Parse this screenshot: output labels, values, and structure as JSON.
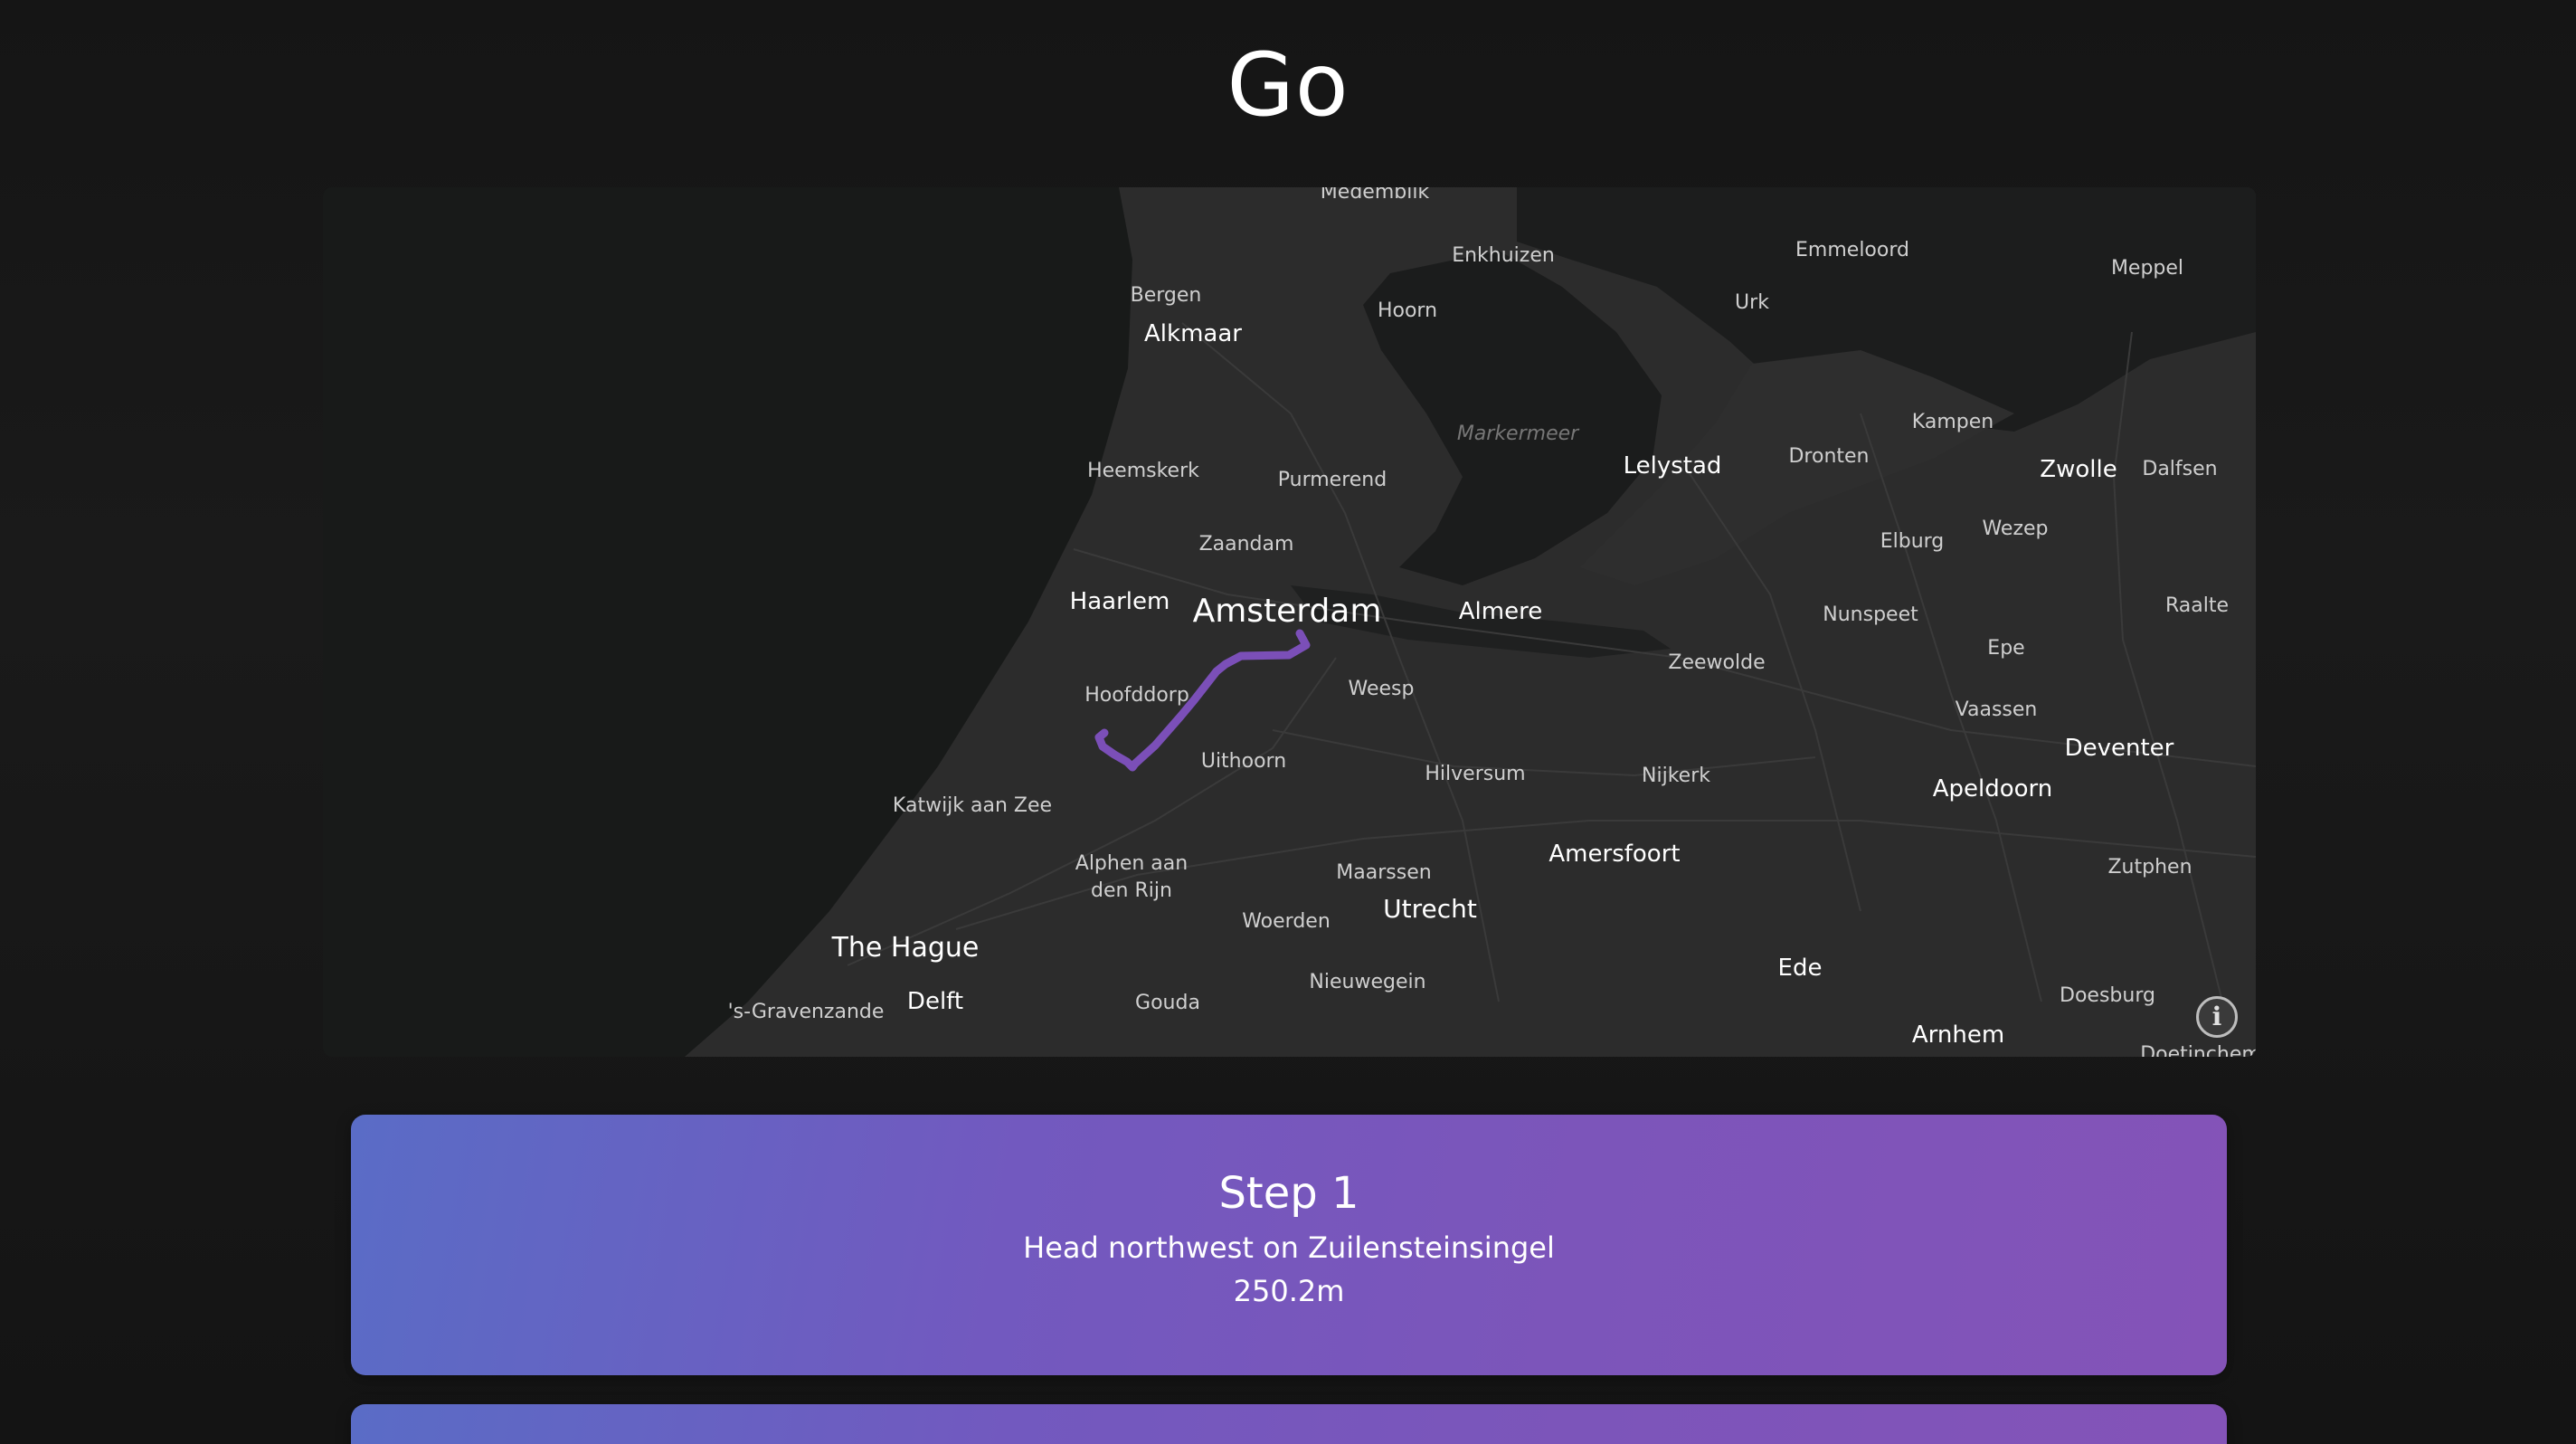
{
  "header": {
    "title": "Go"
  },
  "map": {
    "labels": {
      "medemblik": "Medemblik",
      "enkhuizen": "Enkhuizen",
      "emmeloord": "Emmeloord",
      "meppel": "Meppel",
      "urk": "Urk",
      "bergen": "Bergen",
      "hoorn": "Hoorn",
      "alkmaar": "Alkmaar",
      "markermeer": "Markermeer",
      "heemskerk": "Heemskerk",
      "purmerend": "Purmerend",
      "lelystad": "Lelystad",
      "dronten": "Dronten",
      "kampen": "Kampen",
      "zwolle": "Zwolle",
      "dalfsen": "Dalfsen",
      "zaandam": "Zaandam",
      "elburg": "Elburg",
      "wezep": "Wezep",
      "haarlem": "Haarlem",
      "amsterdam": "Amsterdam",
      "almere": "Almere",
      "nunspeet": "Nunspeet",
      "raalte": "Raalte",
      "hoofddorp": "Hoofddorp",
      "weesp": "Weesp",
      "zeewolde": "Zeewolde",
      "epe": "Epe",
      "vaassen": "Vaassen",
      "deventer": "Deventer",
      "uithoorn": "Uithoorn",
      "hilversum": "Hilversum",
      "nijkerk": "Nijkerk",
      "apeldoorn": "Apeldoorn",
      "katwijk": "Katwijk aan Zee",
      "alphen_line1": "Alphen aan",
      "alphen_line2": "den Rijn",
      "maarssen": "Maarssen",
      "amersfoort": "Amersfoort",
      "zutphen": "Zutphen",
      "utrecht": "Utrecht",
      "the_hague": "The Hague",
      "woerden": "Woerden",
      "ede": "Ede",
      "delft": "Delft",
      "gravenzande": "'s-Gravenzande",
      "gouda": "Gouda",
      "nieuwegein": "Nieuwegein",
      "doesburg": "Doesburg",
      "arnhem": "Arnhem",
      "doetinchem": "Doetinchem"
    },
    "route_color": "#7b4fb8",
    "info_symbol": "i"
  },
  "steps": [
    {
      "title": "Step 1",
      "instruction": "Head northwest on Zuilensteinsingel",
      "distance": "250.2m"
    },
    {
      "title": "",
      "instruction": "",
      "distance": ""
    }
  ],
  "colors": {
    "background": "#161616",
    "map_land": "#2a2a2a",
    "map_water": "#181a19",
    "card_gradient_start": "#5a6cc6",
    "card_gradient_end": "#8453b8"
  }
}
